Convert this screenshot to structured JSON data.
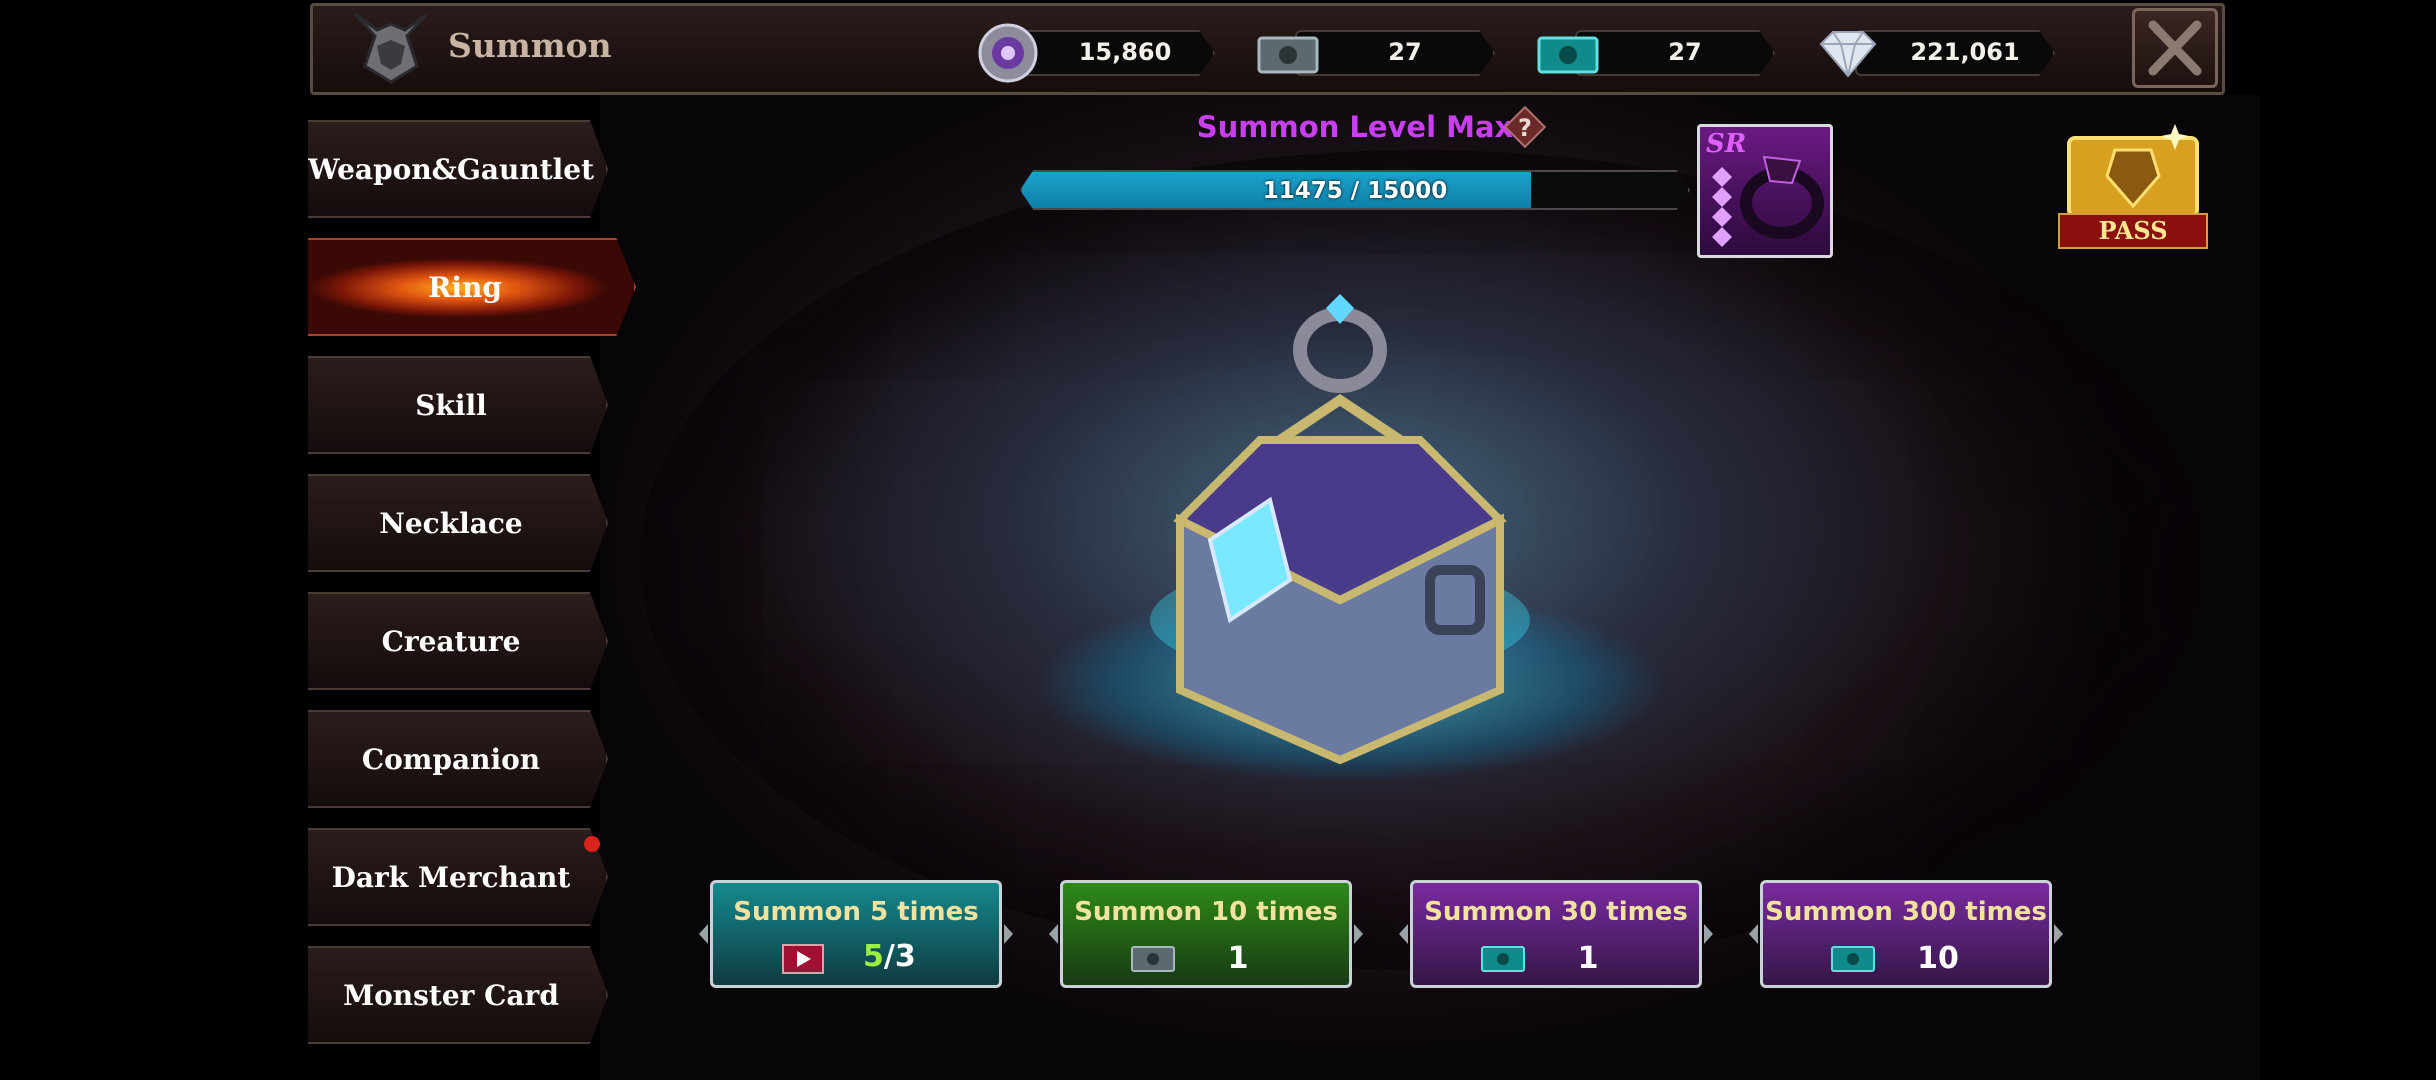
{
  "header": {
    "title": "Summon",
    "resources": [
      {
        "icon": "summon-coin-icon",
        "value": "15,860"
      },
      {
        "icon": "silver-ticket-icon",
        "value": "27"
      },
      {
        "icon": "teal-ticket-icon",
        "value": "27"
      },
      {
        "icon": "diamond-icon",
        "value": "221,061"
      }
    ]
  },
  "sidebar": {
    "items": [
      {
        "label": "Weapon&Gauntlet"
      },
      {
        "label": "Ring"
      },
      {
        "label": "Skill"
      },
      {
        "label": "Necklace"
      },
      {
        "label": "Creature"
      },
      {
        "label": "Companion"
      },
      {
        "label": "Dark Merchant"
      },
      {
        "label": "Monster Card"
      }
    ],
    "active_index": 1
  },
  "level": {
    "title": "Summon Level Max",
    "progress_text": "11475 / 15000",
    "current": 11475,
    "max": 15000
  },
  "reward": {
    "grade": "SR"
  },
  "pass": {
    "label": "PASS"
  },
  "summons": [
    {
      "label": "Summon 5 times",
      "ad_current": "5",
      "ad_limit": "/3",
      "color": "#148a8e"
    },
    {
      "label": "Summon 10 times",
      "cost": "1",
      "cost_icon": "silver-ticket-icon",
      "color": "#2e8a18"
    },
    {
      "label": "Summon 30 times",
      "cost": "1",
      "cost_icon": "teal-ticket-icon",
      "color": "#7a2aa0"
    },
    {
      "label": "Summon 300 times",
      "cost": "10",
      "cost_icon": "teal-ticket-icon",
      "color": "#7a2aa0"
    }
  ],
  "colors": {
    "accent_level": "#c93ef0",
    "bar_fill": "#1aa4cc",
    "active_tab": "#e05510",
    "summon_label": "#f2e2a0"
  }
}
